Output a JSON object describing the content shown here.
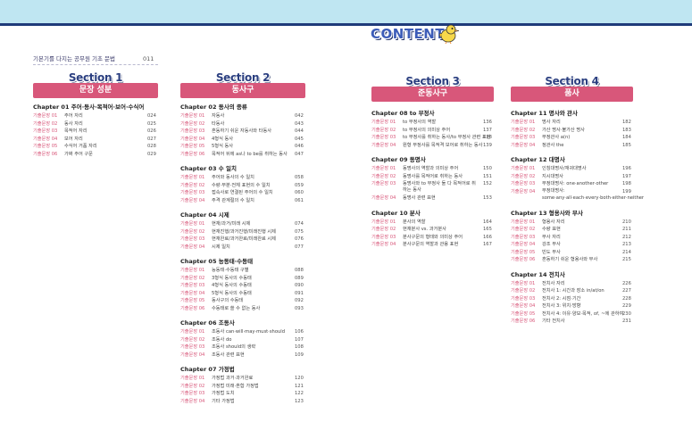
{
  "header": {
    "title": "CONTENTS",
    "mascot": "bird-mascot-icon"
  },
  "intro": {
    "label": "기본기를 다지는 공무원 기초 문법",
    "page": "011"
  },
  "sections": [
    {
      "heading": "Section 1",
      "title": "문장 성분",
      "chapters": [
        {
          "title": "Chapter 01 주어·동사·목적어·보어·수식어",
          "entries": [
            {
              "label": "기출문장 01",
              "title": "주어 자리",
              "page": "024"
            },
            {
              "label": "기출문장 02",
              "title": "동사 자리",
              "page": "025"
            },
            {
              "label": "기출문장 03",
              "title": "목적어 자리",
              "page": "026"
            },
            {
              "label": "기출문장 04",
              "title": "보어 자리",
              "page": "027"
            },
            {
              "label": "기출문장 05",
              "title": "수식어 거품 자리",
              "page": "028"
            },
            {
              "label": "기출문장 06",
              "title": "가짜 주어 구문",
              "page": "029"
            }
          ]
        }
      ]
    },
    {
      "heading": "Section 2",
      "title": "동사구",
      "chapters": [
        {
          "title": "Chapter 02 동사의 종류",
          "entries": [
            {
              "label": "기출문장 01",
              "title": "자동사",
              "page": "042"
            },
            {
              "label": "기출문장 02",
              "title": "타동사",
              "page": "043"
            },
            {
              "label": "기출문장 03",
              "title": "혼동하기 쉬운 자동사와 타동사",
              "page": "044"
            },
            {
              "label": "기출문장 04",
              "title": "4형식 동사",
              "page": "045"
            },
            {
              "label": "기출문장 05",
              "title": "5형식 동사",
              "page": "046"
            },
            {
              "label": "기출문장 06",
              "title": "목적어 뒤에 as나 to be를 취하는 동사",
              "page": "047"
            }
          ]
        },
        {
          "title": "Chapter 03 수 일치",
          "entries": [
            {
              "label": "기출문장 01",
              "title": "주어와 동사의 수 일치",
              "page": "058"
            },
            {
              "label": "기출문장 02",
              "title": "수량·부분·전체 표현의 수 일치",
              "page": "059"
            },
            {
              "label": "기출문장 03",
              "title": "접속사로 연결된 주어의 수 일치",
              "page": "060"
            },
            {
              "label": "기출문장 04",
              "title": "주격 관계절의 수 일치",
              "page": "061"
            }
          ]
        },
        {
          "title": "Chapter 04 시제",
          "entries": [
            {
              "label": "기출문장 01",
              "title": "현재/과거/미래 시제",
              "page": "074"
            },
            {
              "label": "기출문장 02",
              "title": "현재진행/과거진행/미래진행 시제",
              "page": "075"
            },
            {
              "label": "기출문장 03",
              "title": "현재완료/과거완료/미래완료 시제",
              "page": "076"
            },
            {
              "label": "기출문장 04",
              "title": "시제 일치",
              "page": "077"
            }
          ]
        },
        {
          "title": "Chapter 05 능동태·수동태",
          "entries": [
            {
              "label": "기출문장 01",
              "title": "능동태·수동태 구별",
              "page": "088"
            },
            {
              "label": "기출문장 02",
              "title": "3형식 동사의 수동태",
              "page": "089"
            },
            {
              "label": "기출문장 03",
              "title": "4형식 동사의 수동태",
              "page": "090"
            },
            {
              "label": "기출문장 04",
              "title": "5형식 동사의 수동태",
              "page": "091"
            },
            {
              "label": "기출문장 05",
              "title": "동사구의 수동태",
              "page": "092"
            },
            {
              "label": "기출문장 06",
              "title": "수동태로 쓸 수 없는 동사",
              "page": "093"
            }
          ]
        },
        {
          "title": "Chapter 06 조동사",
          "entries": [
            {
              "label": "기출문장 01",
              "title": "조동사 can·will·may·must·should",
              "page": "106"
            },
            {
              "label": "기출문장 02",
              "title": "조동사 do",
              "page": "107"
            },
            {
              "label": "기출문장 03",
              "title": "조동사 should의 생략",
              "page": "108"
            },
            {
              "label": "기출문장 04",
              "title": "조동사 관련 표현",
              "page": "109"
            }
          ]
        },
        {
          "title": "Chapter 07 가정법",
          "entries": [
            {
              "label": "기출문장 01",
              "title": "가정법 과거·과거완료",
              "page": "120"
            },
            {
              "label": "기출문장 02",
              "title": "가정법 미래·혼합 가정법",
              "page": "121"
            },
            {
              "label": "기출문장 03",
              "title": "가정법 도치",
              "page": "122"
            },
            {
              "label": "기출문장 04",
              "title": "기타 가정법",
              "page": "123"
            }
          ]
        }
      ]
    },
    {
      "heading": "Section 3",
      "title": "준동사구",
      "chapters": [
        {
          "title": "Chapter 08 to 부정사",
          "entries": [
            {
              "label": "기출문장 01",
              "title": "to 부정사의 역할",
              "page": "136"
            },
            {
              "label": "기출문장 02",
              "title": "to 부정사의 의미상 주어",
              "page": "137"
            },
            {
              "label": "기출문장 03",
              "title": "to 부정사를 취하는 동사/to 부정사 관련 표현",
              "page": "138"
            },
            {
              "label": "기출문장 04",
              "title": "원형 부정사를 목적격 보어로 취하는 동사",
              "page": "139"
            }
          ]
        },
        {
          "title": "Chapter 09 동명사",
          "entries": [
            {
              "label": "기출문장 01",
              "title": "동명사의 역할과 의미상 주어",
              "page": "150"
            },
            {
              "label": "기출문장 02",
              "title": "동명사를 목적어로 취하는 동사",
              "page": "151"
            },
            {
              "label": "기출문장 03",
              "title": "동명사와 to 부정사 둘 다 목적어로 취하는 동사",
              "page": "152",
              "two": true
            },
            {
              "label": "기출문장 04",
              "title": "동명사 관련 표현",
              "page": "153"
            }
          ]
        },
        {
          "title": "Chapter 10 분사",
          "entries": [
            {
              "label": "기출문장 01",
              "title": "분사의 역할",
              "page": "164"
            },
            {
              "label": "기출문장 02",
              "title": "현재분사 vs. 과거분사",
              "page": "165"
            },
            {
              "label": "기출문장 03",
              "title": "분사구문의 형태와 의미상 주어",
              "page": "166"
            },
            {
              "label": "기출문장 04",
              "title": "분사구문의 역할과 관용 표현",
              "page": "167"
            }
          ]
        }
      ]
    },
    {
      "heading": "Section 4",
      "title": "품사",
      "chapters": [
        {
          "title": "Chapter 11 명사와 관사",
          "entries": [
            {
              "label": "기출문장 01",
              "title": "명사 자리",
              "page": "182"
            },
            {
              "label": "기출문장 02",
              "title": "가산 명사·불가산 명사",
              "page": "183"
            },
            {
              "label": "기출문장 03",
              "title": "부정관사 a(n)",
              "page": "184"
            },
            {
              "label": "기출문장 04",
              "title": "정관사 the",
              "page": "185"
            }
          ]
        },
        {
          "title": "Chapter 12 대명사",
          "entries": [
            {
              "label": "기출문장 01",
              "title": "인칭대명사/재귀대명사",
              "page": "196"
            },
            {
              "label": "기출문장 02",
              "title": "지시대명사",
              "page": "197"
            },
            {
              "label": "기출문장 03",
              "title": "부정대명사: one·another·other",
              "page": "198"
            },
            {
              "label": "기출문장 04",
              "title": "부정대명사: some·any·all·each·every·both·either·neither",
              "page": "199",
              "two": true
            }
          ]
        },
        {
          "title": "Chapter 13 형용사와 부사",
          "entries": [
            {
              "label": "기출문장 01",
              "title": "형용사 자리",
              "page": "210"
            },
            {
              "label": "기출문장 02",
              "title": "수량 표현",
              "page": "211"
            },
            {
              "label": "기출문장 03",
              "title": "부사 자리",
              "page": "212"
            },
            {
              "label": "기출문장 04",
              "title": "강조 부사",
              "page": "213"
            },
            {
              "label": "기출문장 05",
              "title": "빈도 부사",
              "page": "214"
            },
            {
              "label": "기출문장 06",
              "title": "혼동하기 쉬운 형용사와 부사",
              "page": "215"
            }
          ]
        },
        {
          "title": "Chapter 14 전치사",
          "entries": [
            {
              "label": "기출문장 01",
              "title": "전치사 자리",
              "page": "226"
            },
            {
              "label": "기출문장 02",
              "title": "전치사 1: 시간과 장소 in/at/on",
              "page": "227"
            },
            {
              "label": "기출문장 03",
              "title": "전치사 2: 시점·기간",
              "page": "228"
            },
            {
              "label": "기출문장 04",
              "title": "전치사 3: 위치·방향",
              "page": "229"
            },
            {
              "label": "기출문장 05",
              "title": "전치사 4: 이유·양보·목적, of, ~에 관하여",
              "page": "230"
            },
            {
              "label": "기출문장 06",
              "title": "기타 전치사",
              "page": "231"
            }
          ]
        }
      ]
    }
  ]
}
